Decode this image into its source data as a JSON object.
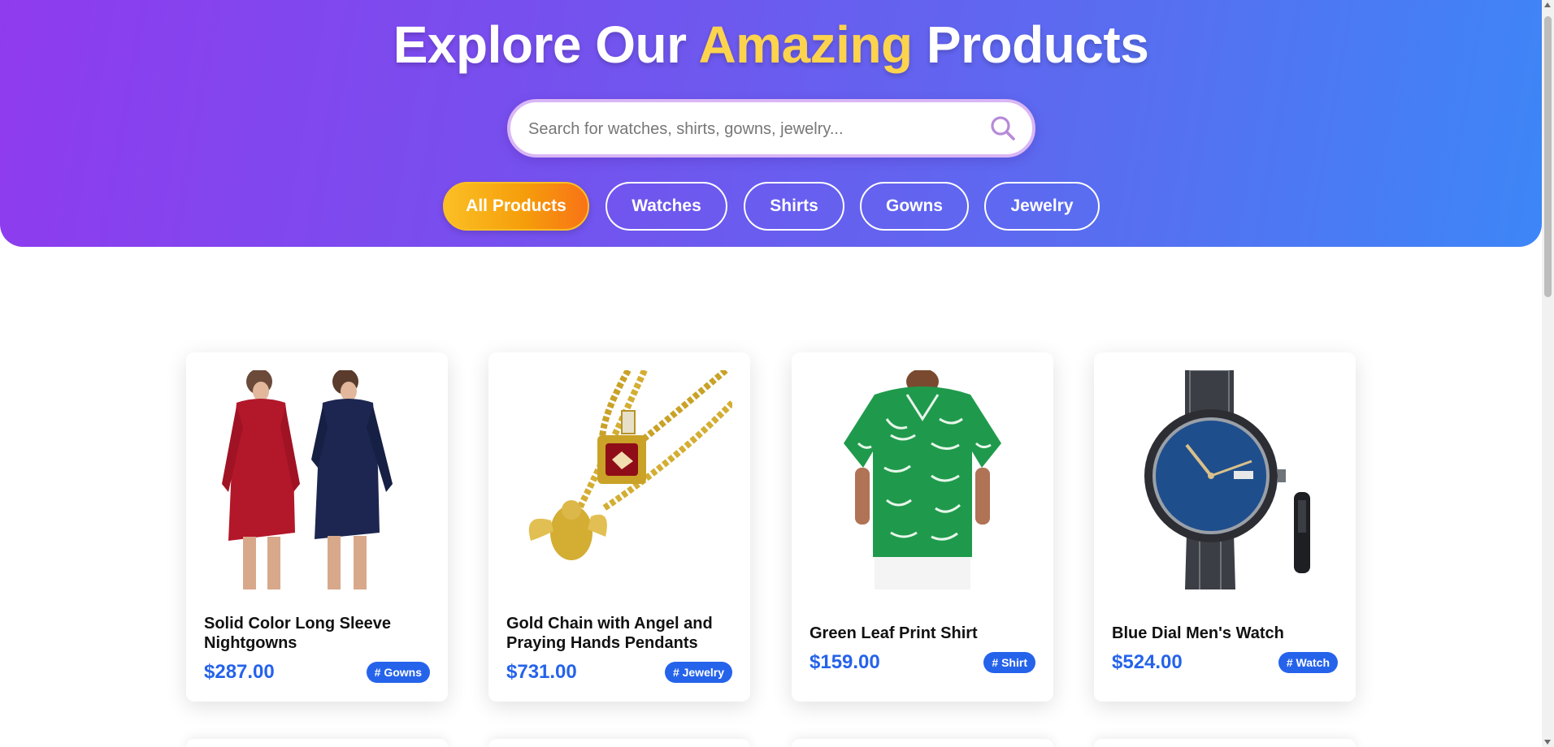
{
  "header": {
    "title_before": "Explore Our",
    "title_highlight": "Amazing",
    "title_after": "Products",
    "highlight_color": "#fcd34d",
    "gradient_colors": [
      "#8f3bee",
      "#3d86f7"
    ]
  },
  "search": {
    "placeholder": "Search for watches, shirts, gowns, jewelry...",
    "value": "",
    "icon": "search-icon"
  },
  "filters": [
    {
      "label": "All Products",
      "active": true
    },
    {
      "label": "Watches",
      "active": false
    },
    {
      "label": "Shirts",
      "active": false
    },
    {
      "label": "Gowns",
      "active": false
    },
    {
      "label": "Jewelry",
      "active": false
    }
  ],
  "products": [
    {
      "name": "Solid Color Long Sleeve Nightgowns",
      "price": "$287.00",
      "tag": "# Gowns",
      "image": "nightgowns-image"
    },
    {
      "name": "Gold Chain with Angel and Praying Hands Pendants",
      "price": "$731.00",
      "tag": "# Jewelry",
      "image": "gold-chain-image"
    },
    {
      "name": "Green Leaf Print Shirt",
      "price": "$159.00",
      "tag": "# Shirt",
      "image": "leaf-shirt-image"
    },
    {
      "name": "Blue Dial Men's Watch",
      "price": "$524.00",
      "tag": "# Watch",
      "image": "watch-image"
    }
  ],
  "colors": {
    "price": "#2563eb",
    "tag_bg": "#2563eb",
    "active_chip": "#f59e0b"
  }
}
